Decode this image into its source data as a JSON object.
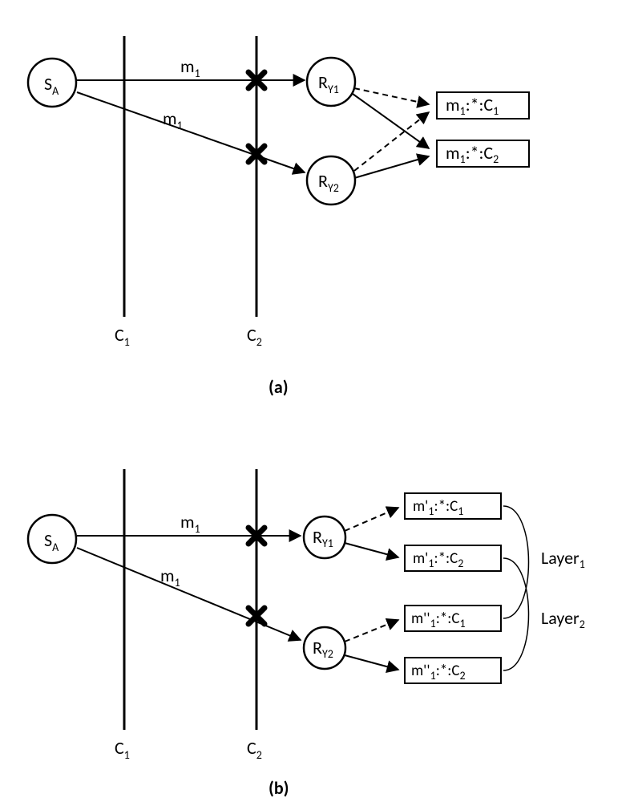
{
  "diagram_a": {
    "source_label": "S",
    "source_sub": "A",
    "cut1": "C",
    "cut1_sub": "1",
    "cut2": "C",
    "cut2_sub": "2",
    "msg_top": "m",
    "msg_top_sub": "1",
    "msg_bot": "m",
    "msg_bot_sub": "1",
    "recv1": "R",
    "recv1_sub": "Y1",
    "recv2": "R",
    "recv2_sub": "Y2",
    "out1_pre": "m",
    "out1_sub": "1",
    "out1_mid": ":*:C",
    "out1_suf": "1",
    "out2_pre": "m",
    "out2_sub": "1",
    "out2_mid": ":*:C",
    "out2_suf": "2",
    "caption": "(a)"
  },
  "diagram_b": {
    "source_label": "S",
    "source_sub": "A",
    "cut1": "C",
    "cut1_sub": "1",
    "cut2": "C",
    "cut2_sub": "2",
    "msg_top": "m",
    "msg_top_sub": "1",
    "msg_bot": "m",
    "msg_bot_sub": "1",
    "recv1": "R",
    "recv1_sub": "Y1",
    "recv2": "R",
    "recv2_sub": "Y2",
    "b1_pre": "m'",
    "b1_sub": "1",
    "b1_mid": ":*:C",
    "b1_suf": "1",
    "b2_pre": "m'",
    "b2_sub": "1",
    "b2_mid": ":*:C",
    "b2_suf": "2",
    "b3_pre": "m''",
    "b3_sub": "1",
    "b3_mid": ":*:C",
    "b3_suf": "1",
    "b4_pre": "m''",
    "b4_sub": "1",
    "b4_mid": ":*:C",
    "b4_suf": "2",
    "layer1": "Layer",
    "layer1_sub": "1",
    "layer2": "Layer",
    "layer2_sub": "2",
    "caption": "(b)"
  }
}
